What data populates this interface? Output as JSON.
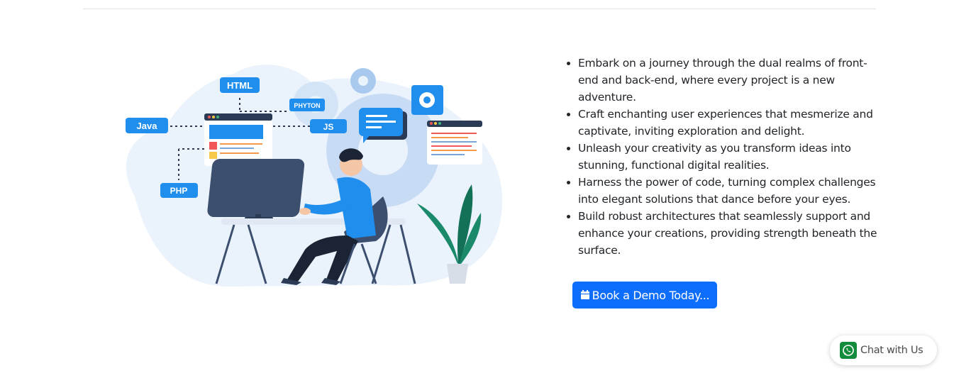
{
  "illustration": {
    "tags": {
      "html": "HTML",
      "java": "Java",
      "phyton": "PHYTON",
      "js": "JS",
      "php": "PHP"
    }
  },
  "features": {
    "items": [
      "Embark on a journey through the dual realms of front-end and back-end, where every project is a new adventure.",
      "Craft enchanting user experiences that mesmerize and captivate, inviting exploration and delight.",
      "Unleash your creativity as you transform ideas into stunning, functional digital realities.",
      "Harness the power of code, turning complex challenges into elegant solutions that dance before your eyes.",
      "Build robust architectures that seamlessly support and enhance your creations, providing strength beneath the surface."
    ]
  },
  "cta": {
    "label": "Book a Demo Today...",
    "icon": "calendar-icon",
    "color": "#0d6efd"
  },
  "chat": {
    "label": "Chat with Us",
    "icon": "whatsapp-icon",
    "color": "#128c3c"
  }
}
